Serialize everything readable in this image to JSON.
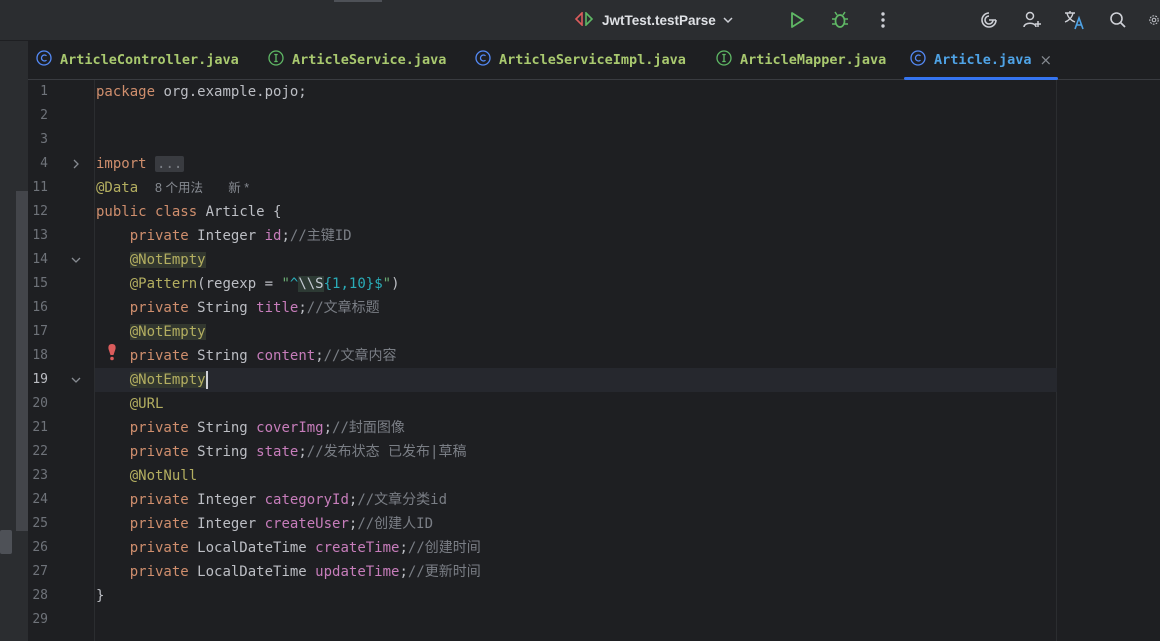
{
  "toolbar": {
    "run_config": "JwtTest.testParse"
  },
  "tabs": [
    {
      "label": "ArticleController.java",
      "kind": "C",
      "active": false
    },
    {
      "label": "ArticleService.java",
      "kind": "I",
      "active": false
    },
    {
      "label": "ArticleServiceImpl.java",
      "kind": "C",
      "active": false
    },
    {
      "label": "ArticleMapper.java",
      "kind": "I",
      "active": false
    },
    {
      "label": "Article.java",
      "kind": "C",
      "active": true
    }
  ],
  "tab_close_symbol": "×",
  "line_numbers": [
    "1",
    "2",
    "3",
    "4",
    "11",
    "12",
    "13",
    "14",
    "15",
    "16",
    "17",
    "18",
    "19",
    "20",
    "21",
    "22",
    "23",
    "24",
    "25",
    "26",
    "27",
    "28",
    "29"
  ],
  "current_line": "19",
  "code": {
    "l1_kw": "package",
    "l1_rest": " org.example.pojo;",
    "l4_kw": "import",
    "l4_fold": "...",
    "l11_anno": "@Data",
    "l11_usages": "8 个用法",
    "l11_new": "新 *",
    "l12_kw1": "public",
    "l12_kw2": "class",
    "l12_rest": " Article {",
    "l13_kw": "private",
    "l13_type": " Integer ",
    "l13_field": "id",
    "l13_semi": ";",
    "l13_comment": "//主键ID",
    "l14_anno": "@NotEmpty",
    "l15_anno": "@Pattern",
    "l15_a": "(regexp = ",
    "l15_q1": "\"",
    "l15_caret": "^",
    "l15_esc": "\\\\S",
    "l15_brace": "{1,10}",
    "l15_dollar": "$",
    "l15_q2": "\"",
    "l15_close": ")",
    "l16_kw": "private",
    "l16_type": " String ",
    "l16_field": "title",
    "l16_semi": ";",
    "l16_comment": "//文章标题",
    "l17_anno": "@NotEmpty",
    "l18_kw": "private",
    "l18_type": " String ",
    "l18_field": "content",
    "l18_semi": ";",
    "l18_comment": "//文章内容",
    "l19_anno": "@NotEmpty",
    "l20_anno": "@URL",
    "l21_kw": "private",
    "l21_type": " String ",
    "l21_field": "coverImg",
    "l21_semi": ";",
    "l21_comment": "//封面图像",
    "l22_kw": "private",
    "l22_type": " String ",
    "l22_field": "state",
    "l22_semi": ";",
    "l22_comment": "//发布状态 已发布|草稿",
    "l23_anno": "@NotNull",
    "l24_kw": "private",
    "l24_type": " Integer ",
    "l24_field": "categoryId",
    "l24_semi": ";",
    "l24_comment": "//文章分类id",
    "l25_kw": "private",
    "l25_type": " Integer ",
    "l25_field": "createUser",
    "l25_semi": ";",
    "l25_comment": "//创建人ID",
    "l26_kw": "private",
    "l26_type": " LocalDateTime ",
    "l26_field": "createTime",
    "l26_semi": ";",
    "l26_comment": "//创建时间",
    "l27_kw": "private",
    "l27_type": " LocalDateTime ",
    "l27_field": "updateTime",
    "l27_semi": ";",
    "l27_comment": "//更新时间",
    "l28": "}"
  },
  "colors": {
    "background": "#1e1f22",
    "keyword": "#cf8e6d",
    "annotation": "#b3ae60",
    "field": "#c77dbb",
    "comment": "#7a7e85",
    "string": "#6aab73",
    "accent": "#3574f0",
    "error": "#db5c5c"
  }
}
